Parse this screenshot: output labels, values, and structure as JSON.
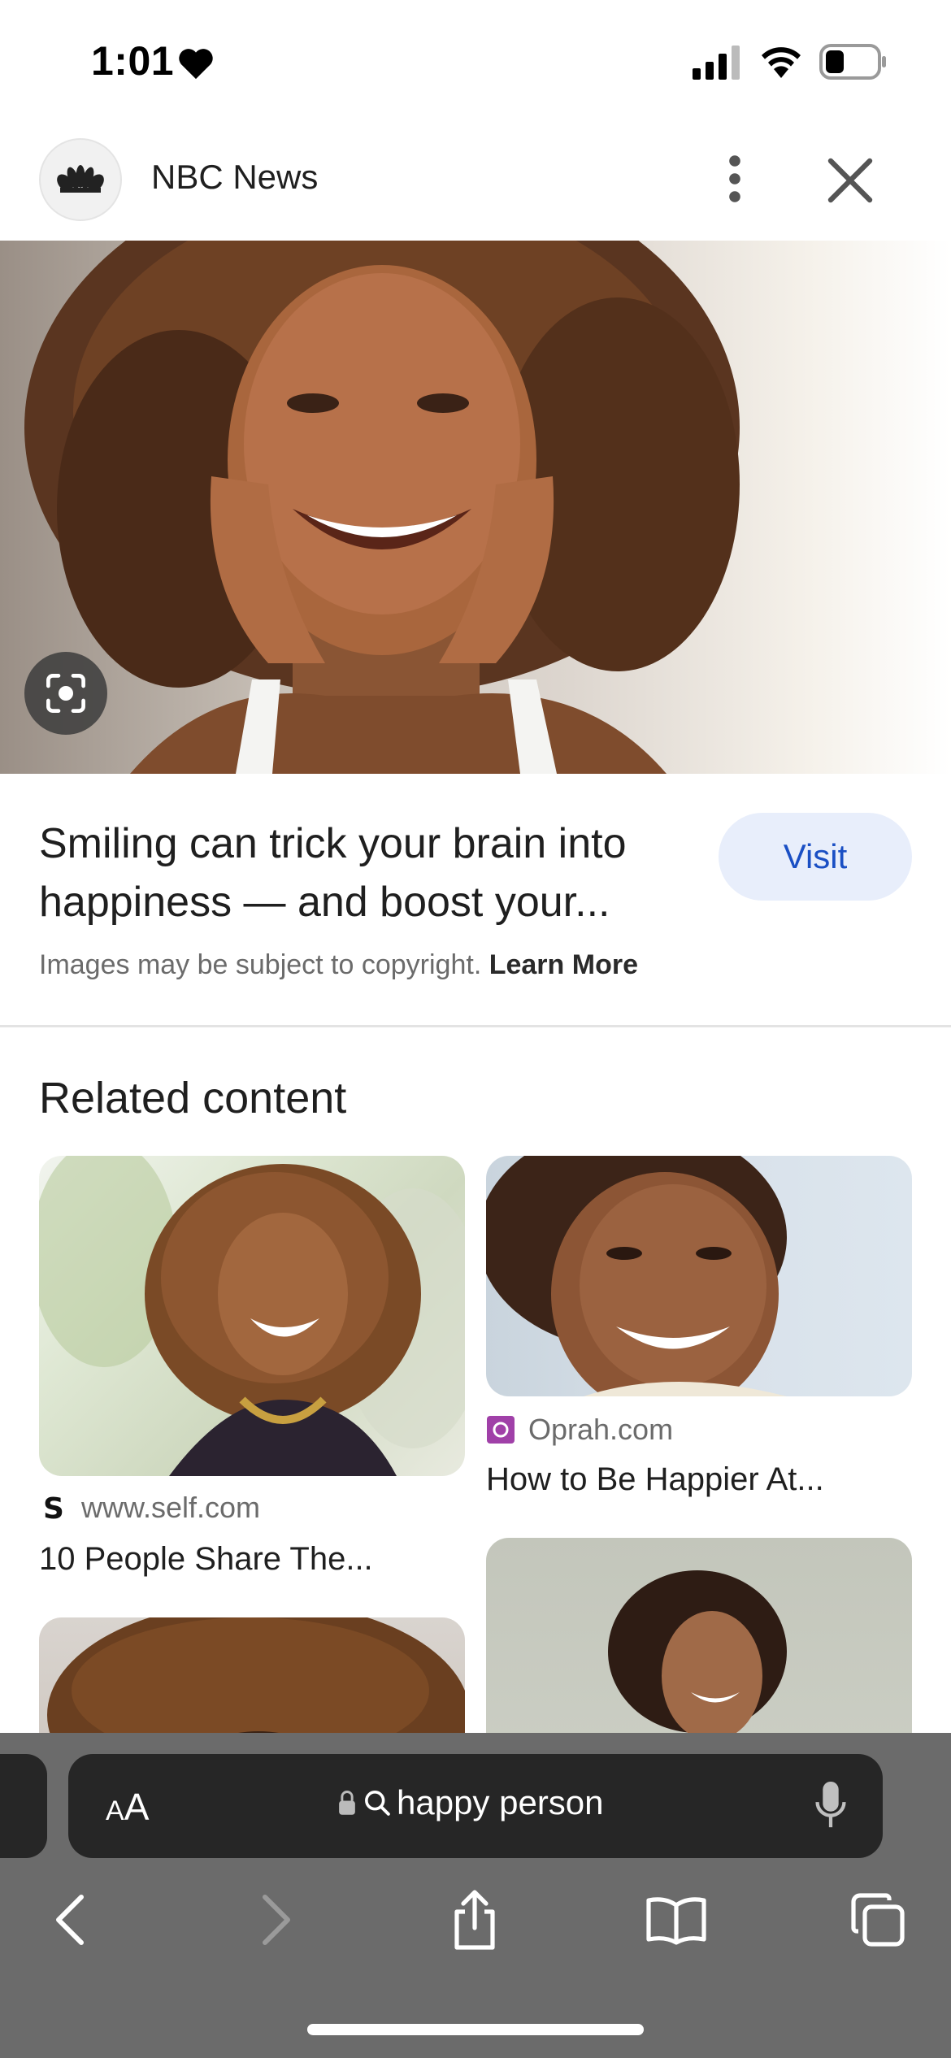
{
  "status_bar": {
    "time": "1:01"
  },
  "header": {
    "source_name": "NBC News"
  },
  "result": {
    "title": "Smiling can trick your brain into happiness — and boost your...",
    "visit_label": "Visit",
    "copyright_text": "Images may be subject to copyright.",
    "learn_more": "Learn More"
  },
  "related": {
    "heading": "Related content",
    "items": [
      {
        "source": "www.self.com",
        "title": "10 People Share The..."
      },
      {
        "source": "Oprah.com",
        "title": "How to Be Happier At..."
      }
    ]
  },
  "browser": {
    "text_size_label": "AA",
    "search_query": "happy person"
  },
  "colors": {
    "visit_bg": "#e8eefb",
    "visit_text": "#1a4fc4",
    "toolbar_bg": "#6b6b6b",
    "oprah_brand": "#a040a8"
  },
  "icons": [
    "heart-icon",
    "cellular-signal-icon",
    "wifi-icon",
    "battery-icon",
    "nbc-peacock-icon",
    "more-vertical-icon",
    "close-icon",
    "lens-icon",
    "self-logo-icon",
    "oprah-logo-icon",
    "lock-icon",
    "search-icon",
    "microphone-icon",
    "back-icon",
    "forward-icon",
    "share-icon",
    "bookmarks-icon",
    "tabs-icon"
  ]
}
